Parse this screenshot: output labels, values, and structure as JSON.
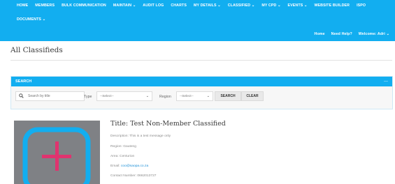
{
  "nav": {
    "items": [
      "HOME",
      "MEMBERS",
      "BULK COMMUNICATION",
      "MAINTAIN ⌄",
      "AUDIT LOG",
      "CHARTS",
      "MY DETAILS ⌄",
      "CLASSIFIED ⌄",
      "MY CPD ⌄",
      "EVENTS ⌄",
      "WEBSITE BUILDER",
      "ISPO"
    ],
    "row2": [
      "DOCUMENTS ⌄"
    ],
    "right": [
      "Home",
      "Need Help?",
      "Welcome: Adri ⌄"
    ]
  },
  "page": {
    "title": "All Classifieds"
  },
  "search": {
    "header": "SEARCH",
    "placeholder": "Search by title",
    "type_label": "Type",
    "type_value": "--Select--",
    "region_label": "Region",
    "region_value": "--Select--",
    "search_button": "SEARCH",
    "clear_button": "CLEAR"
  },
  "classified": {
    "title": "Title: Test Non-Member Classified",
    "description": "Description: This is a test message only",
    "region": "Region: Gauteng",
    "area": "Area: Centurion",
    "email_label": "Email: ",
    "email": "coo@saopa.co.za",
    "contact": "Contact Number: 0662013727"
  },
  "colors": {
    "brand": "#12aef0",
    "placeholder_bg": "#7f8185",
    "icon_frame": "#12aef0",
    "icon_plus": "#e0336f"
  }
}
